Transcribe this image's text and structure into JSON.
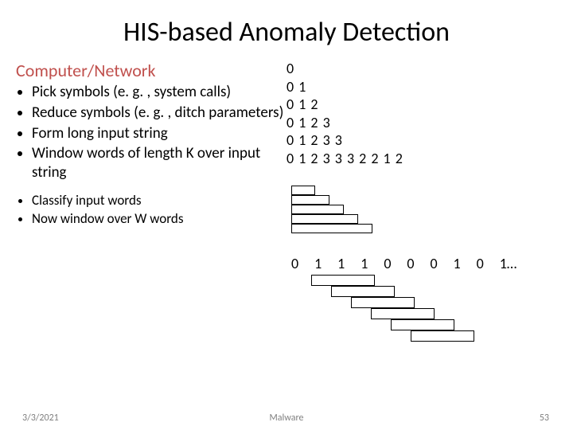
{
  "title": "HIS-based Anomaly Detection",
  "section_heading": "Computer/Network",
  "bullets_main": [
    "Pick symbols (e. g. , system calls)",
    "Reduce symbols (e. g. , ditch parameters)",
    "Form long input string",
    "Window words of length K over input string"
  ],
  "bullets_secondary": [
    "Classify input words",
    "Now window over W words"
  ],
  "triangle_rows": [
    "0",
    "0  1",
    "0  1  2",
    "0  1  2  3",
    "0  1  2  3  3",
    "0  1  2  3  3  3  2  2  1  2"
  ],
  "row2_digits": [
    "0",
    "1",
    "1",
    "1",
    "0",
    "0",
    "0",
    "1",
    "0",
    "1…"
  ],
  "footer": {
    "date": "3/3/2021",
    "center": "Malware",
    "page": "53"
  }
}
